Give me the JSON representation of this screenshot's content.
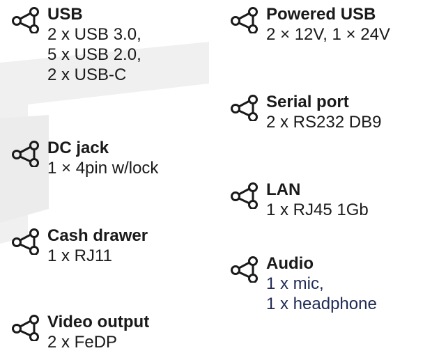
{
  "colors": {
    "text": "#1a1a1a",
    "accent_text": "#1f2a55",
    "background_shape": "#eeeeee"
  },
  "items": {
    "usb": {
      "icon": "share-icon",
      "title": "USB",
      "lines": [
        "2 x USB 3.0,",
        "5 x USB 2.0,",
        "2 x USB-C"
      ]
    },
    "dc_jack": {
      "icon": "share-icon",
      "title": "DC jack",
      "lines": [
        "1 × 4pin w/lock"
      ]
    },
    "cash_drawer": {
      "icon": "share-icon",
      "title": "Cash drawer",
      "lines": [
        "1 x RJ11"
      ]
    },
    "video_output": {
      "icon": "share-icon",
      "title": "Video output",
      "lines": [
        "2 x FeDP"
      ]
    },
    "powered_usb": {
      "icon": "share-icon",
      "title": "Powered USB",
      "lines": [
        "2 × 12V, 1 × 24V"
      ]
    },
    "serial_port": {
      "icon": "share-icon",
      "title": "Serial port",
      "lines": [
        "2 x RS232 DB9"
      ]
    },
    "lan": {
      "icon": "share-icon",
      "title": "LAN",
      "lines": [
        "1 x RJ45 1Gb"
      ]
    },
    "audio": {
      "icon": "share-icon",
      "title": "Audio",
      "lines": [
        "1 x mic,",
        "1 x headphone"
      ]
    }
  }
}
